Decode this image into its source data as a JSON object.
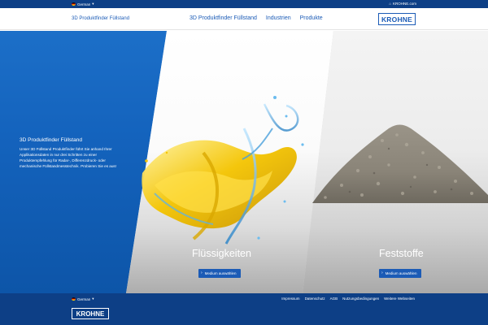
{
  "topbar": {
    "language": "German",
    "krohne_link": "KROHNE.com"
  },
  "navbar": {
    "brand_title": "3D Produktfinder Füllstand",
    "links": [
      "3D Produktfinder Füllstand",
      "Industrien",
      "Produkte"
    ],
    "logo_text": "KROHNE"
  },
  "hero": {
    "heading": "3D Produktfinder Füllstand",
    "description": "Unser 3D Füllstand Produktfinder führt Sie anhand Ihrer Applikationsdaten in nur drei Schritten zu einer Produktempfehlung für Radar-, Differenzdruck- oder mechanische Füllstandmesstechnik. Probieren Sie es aus!"
  },
  "categories": [
    {
      "title": "Flüssigkeiten",
      "button": "Medium auswählen"
    },
    {
      "title": "Feststoffe",
      "button": "Medium auswählen"
    }
  ],
  "footer": {
    "language": "German",
    "links": [
      "Impressum",
      "Datenschutz",
      "AGB",
      "Nutzungsbedingungen",
      "Weitere Webseiten"
    ],
    "logo_text": "KROHNE"
  },
  "colors": {
    "brand_blue": "#1b5bb6",
    "dark_blue": "#0d3f86",
    "accent_yellow": "#f4c400"
  }
}
